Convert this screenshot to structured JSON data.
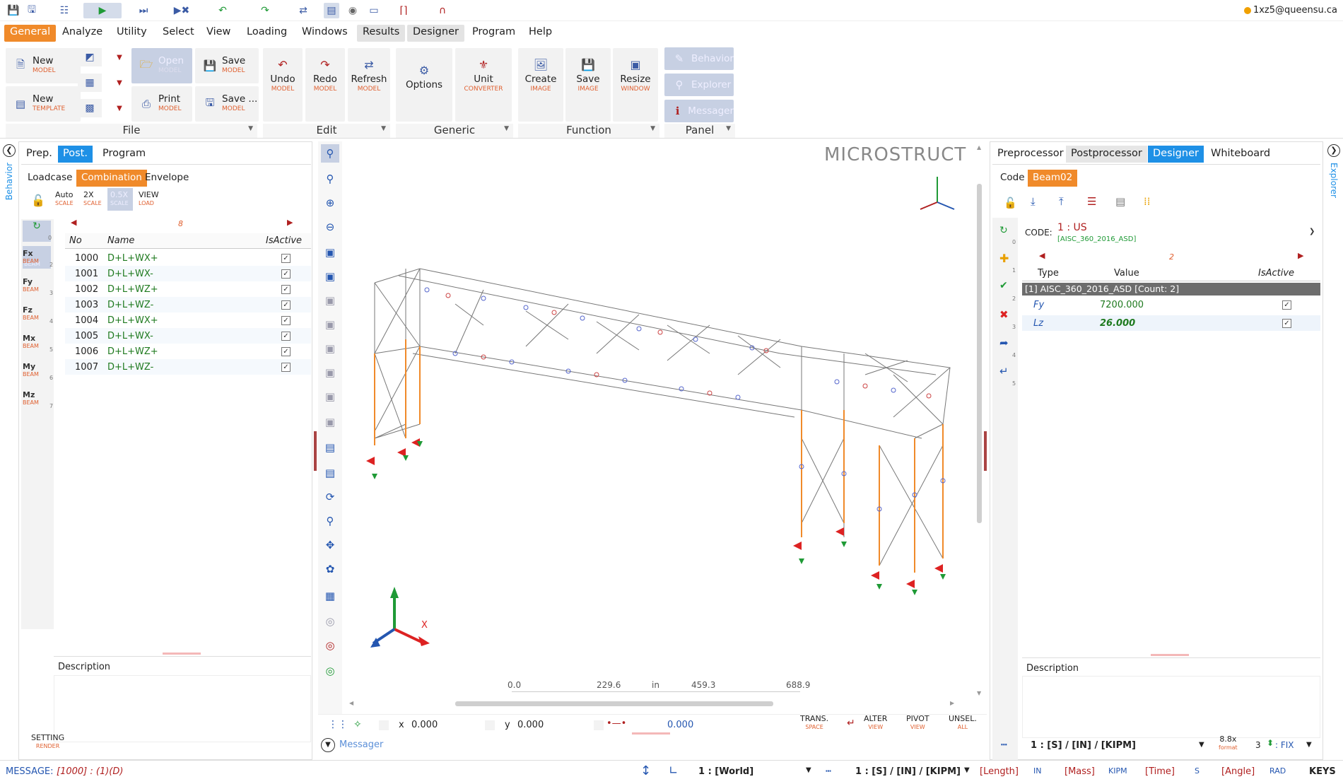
{
  "titlebar": {
    "user": "1xz5@queensu.ca"
  },
  "menu": [
    "General",
    "Analyze",
    "Utility",
    "Select",
    "View",
    "Loading",
    "Windows",
    "Results",
    "Designer",
    "Program",
    "Help"
  ],
  "ribbon": {
    "new_model": {
      "label": "New",
      "sub": "MODEL"
    },
    "new_template": {
      "label": "New",
      "sub": "TEMPLATE"
    },
    "open_model": {
      "label": "Open",
      "sub": "MODEL"
    },
    "print_model": {
      "label": "Print",
      "sub": "MODEL"
    },
    "save_model": {
      "label": "Save",
      "sub": "MODEL"
    },
    "save_as_model": {
      "label": "Save ...",
      "sub": "MODEL"
    },
    "undo": {
      "label": "Undo",
      "sub": "MODEL"
    },
    "redo": {
      "label": "Redo",
      "sub": "MODEL"
    },
    "refresh": {
      "label": "Refresh",
      "sub": "MODEL"
    },
    "options": {
      "label": "Options"
    },
    "unit": {
      "label": "Unit",
      "sub": "CONVERTER"
    },
    "create_image": {
      "label": "Create",
      "sub": "IMAGE"
    },
    "save_image": {
      "label": "Save",
      "sub": "IMAGE"
    },
    "resize_window": {
      "label": "Resize",
      "sub": "WINDOW"
    },
    "behavior": "Behavior",
    "explorer": "Explorer",
    "messager": "Messager",
    "groups": [
      "File",
      "Edit",
      "Generic",
      "Function",
      "Panel"
    ]
  },
  "left": {
    "side_label": "Behavior",
    "tabs": [
      "Prep.",
      "Post.",
      "Program"
    ],
    "subtabs": [
      "Loadcase",
      "Combination",
      "Envelope"
    ],
    "scale": [
      {
        "label": "Auto",
        "sub": "SCALE"
      },
      {
        "label": "2X",
        "sub": "SCALE"
      },
      {
        "label": "0.5X",
        "sub": "SCALE"
      },
      {
        "label": "VIEW",
        "sub": "LOAD"
      }
    ],
    "count": "8",
    "columns": {
      "no": "No",
      "name": "Name",
      "active": "IsActive"
    },
    "rows": [
      {
        "no": "1000",
        "name": "D+L+WX+"
      },
      {
        "no": "1001",
        "name": "D+L+WX-"
      },
      {
        "no": "1002",
        "name": "D+L+WZ+"
      },
      {
        "no": "1003",
        "name": "D+L+WZ-"
      },
      {
        "no": "1004",
        "name": "D+L+WX+"
      },
      {
        "no": "1005",
        "name": "D+L+WX-"
      },
      {
        "no": "1006",
        "name": "D+L+WZ+"
      },
      {
        "no": "1007",
        "name": "D+L+WZ-"
      }
    ],
    "side_items": [
      {
        "label": "",
        "sub": "BEAM",
        "num": "1"
      },
      {
        "label": "Fx",
        "sub": "BEAM",
        "num": "2"
      },
      {
        "label": "Fy",
        "sub": "BEAM",
        "num": "3"
      },
      {
        "label": "Fz",
        "sub": "BEAM",
        "num": "4"
      },
      {
        "label": "Mx",
        "sub": "BEAM",
        "num": "5"
      },
      {
        "label": "My",
        "sub": "BEAM",
        "num": "6"
      },
      {
        "label": "Mz",
        "sub": "BEAM",
        "num": "7"
      }
    ],
    "description": "Description",
    "setting": {
      "label": "SETTING",
      "sub": "RENDER"
    }
  },
  "viewport": {
    "brand": "MICROSTRUCT",
    "axis_x": "X",
    "ruler": [
      "0.0",
      "229.6",
      "in",
      "459.3",
      "688.9"
    ],
    "x_value": "0.000",
    "y_value": "0.000",
    "d_value": "0.000",
    "x_label": "x",
    "y_label": "y",
    "controls": [
      {
        "label": "TRANS.",
        "sub": "SPACE"
      },
      {
        "label": "ALTER",
        "sub": "VIEW"
      },
      {
        "label": "PIVOT",
        "sub": "VIEW"
      },
      {
        "label": "UNSEL.",
        "sub": "ALL"
      }
    ],
    "messager": "Messager"
  },
  "right": {
    "side_label": "Explorer",
    "tabs": [
      "Preprocessor",
      "Postprocessor",
      "Designer",
      "Whiteboard"
    ],
    "subtabs": [
      "Code",
      "Beam02"
    ],
    "code_label": "CODE:",
    "code_value": "1 : US",
    "code_sub": "[AISC_360_2016_ASD]",
    "count": "2",
    "columns": {
      "type": "Type",
      "value": "Value",
      "active": "IsActive"
    },
    "group_header": "[1] AISC_360_2016_ASD   [Count: 2]",
    "rows": [
      {
        "type": "Fy",
        "value": "7200.000"
      },
      {
        "type": "Lz",
        "value": "26.000"
      }
    ],
    "side_nums": [
      "0",
      "1",
      "2",
      "3",
      "4",
      "5"
    ],
    "description": "Description",
    "unit_system": "1 : [S] / [IN] / [KIPM]",
    "format": {
      "label": "8.8x",
      "sub": "format"
    },
    "precision": "3",
    "fix": ": FIX"
  },
  "status": {
    "message_label": "MESSAGE:",
    "message": "[1000] : (1)(D)",
    "world": "1 : [World]",
    "units": "1 : [S] / [IN] / [KIPM]",
    "items": [
      "[Length]",
      "IN",
      "[Mass]",
      "KIPM",
      "[Time]",
      "S",
      "[Angle]",
      "RAD",
      "KEYS"
    ]
  }
}
